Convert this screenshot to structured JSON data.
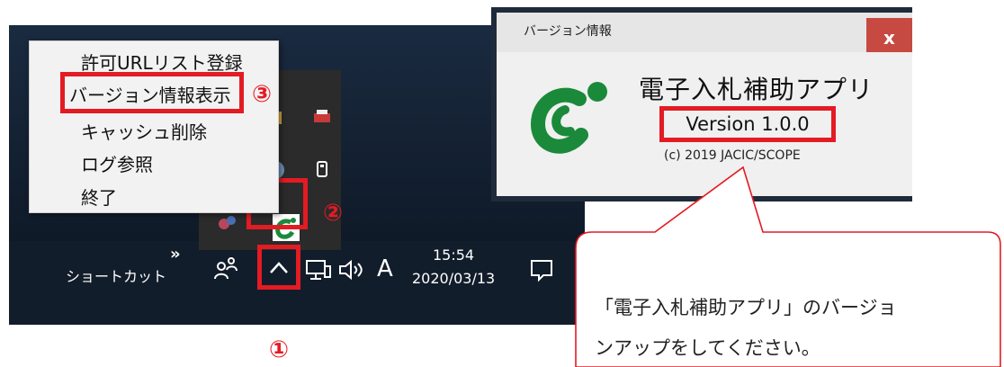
{
  "context_menu": {
    "items": [
      "許可URLリスト登録",
      "バージョン情報表示",
      "キャッシュ削除",
      "ログ参照",
      "終了"
    ]
  },
  "taskbar": {
    "shortcut_label": "ショートカット",
    "expand_glyph": "»",
    "show_hidden_glyph": "^",
    "ime_label": "A",
    "time": "15:54",
    "date": "2020/03/13"
  },
  "markers": {
    "step1": "①",
    "step2": "②",
    "step3": "③"
  },
  "dialog": {
    "title": "バージョン情報",
    "close_label": "x",
    "app_name": "電子入札補助アプリ",
    "version": "Version 1.0.0",
    "copyright": "(c) 2019 JACIC/SCOPE"
  },
  "callout": {
    "line1": "「電子入札補助アプリ」のバージョ",
    "line2": "ンアップをしてください。"
  },
  "colors": {
    "highlight": "#e31b23",
    "logo_green": "#1a8a3a"
  }
}
